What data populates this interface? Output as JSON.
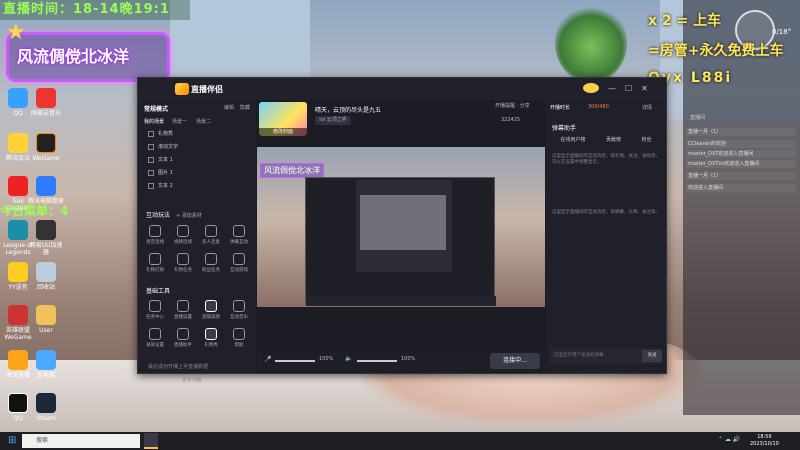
{
  "overlay": {
    "ticker": "直播时间：18-14晚19:1",
    "streamer_name": "风流倜傥北冰洋",
    "today_menu": "今日菜单：4",
    "line1": "x 2 = 上车",
    "line2": "=房管+永久免费上车",
    "line3": "Qyx L88i"
  },
  "desktop_icons": [
    {
      "label": "QQ"
    },
    {
      "label": "网易云音乐"
    },
    {
      "label": "腾讯会议"
    },
    {
      "label": "WeGame"
    },
    {
      "label": "Tool Cleaner"
    },
    {
      "label": "腾讯电脑管家"
    },
    {
      "label": "League of Legends"
    },
    {
      "label": "网易UU加速器"
    },
    {
      "label": "YY语音"
    },
    {
      "label": "回收站"
    },
    {
      "label": "英雄联盟WeGame"
    },
    {
      "label": "User"
    },
    {
      "label": "虎牙直播"
    },
    {
      "label": "此电脑"
    },
    {
      "label": "QQ"
    },
    {
      "label": "Steam"
    }
  ],
  "app": {
    "brand": "直播伴侣",
    "mode": "常规模式",
    "tab_edit": "编辑",
    "tab_hide": "隐藏",
    "scene_tabs": [
      "我的场景",
      "场景一",
      "场景二"
    ],
    "sources": [
      "礼物秀",
      "滚动文字",
      "文本 1",
      "图片 1",
      "文本 2"
    ],
    "add_source": "+ 添加素材",
    "interact_title": "互动玩法",
    "interact_tools": [
      "语音连线",
      "视频连线",
      "多人连麦",
      "弹幕互动",
      "礼物打榜",
      "礼物任务",
      "粉丝任务",
      "互动游戏"
    ],
    "basic_title": "基础工具",
    "basic_tools": [
      "任务中心",
      "直播设置",
      "滤镜美颜",
      "互动音乐",
      "录屏设置",
      "直播助手",
      "礼物秀",
      "帮助"
    ],
    "more": "更多功能",
    "stream_title": "晴天，云顶的尽头是九五",
    "category": "lol 云顶之弈",
    "edit_cover": "修改封面",
    "favorites": "开播提醒",
    "share": "分享",
    "viewers": "322425",
    "preview_name": "风流倜傥北冰洋",
    "mic_pct": "100%",
    "spk_pct": "100%",
    "go_live": "连接中...",
    "status": "最近成功开播上半直播数据",
    "controls": [
      "—",
      "☐",
      "✕"
    ]
  },
  "right_pane": {
    "header": "开播时长",
    "hot": "300/480",
    "detail": "详情",
    "title": "弹幕助手",
    "segments": [
      "在线用户榜",
      "贡献榜",
      "粉丝"
    ],
    "tip1": "这里显示直播间的互动消息，如礼物、关注、进场等，可以在设置中调整显示。",
    "tip2": "这里显示直播间的互动消息，如弹幕、礼物、关注等。",
    "input_placeholder": "这里显示用户发送的弹幕",
    "send": "发送"
  },
  "chat_panel": {
    "weather": "0/18°",
    "header": "直播间",
    "lines": [
      "直播一月（1）",
      "CCleaner的欢迎",
      "master_DXT欢迎进入直播间",
      "master_DXTxx欢迎进入直播间",
      "直播一月（1）",
      "欢迎进入直播间"
    ]
  },
  "taskbar": {
    "search": "搜索",
    "time": "18:59",
    "date": "2023/10/10"
  }
}
